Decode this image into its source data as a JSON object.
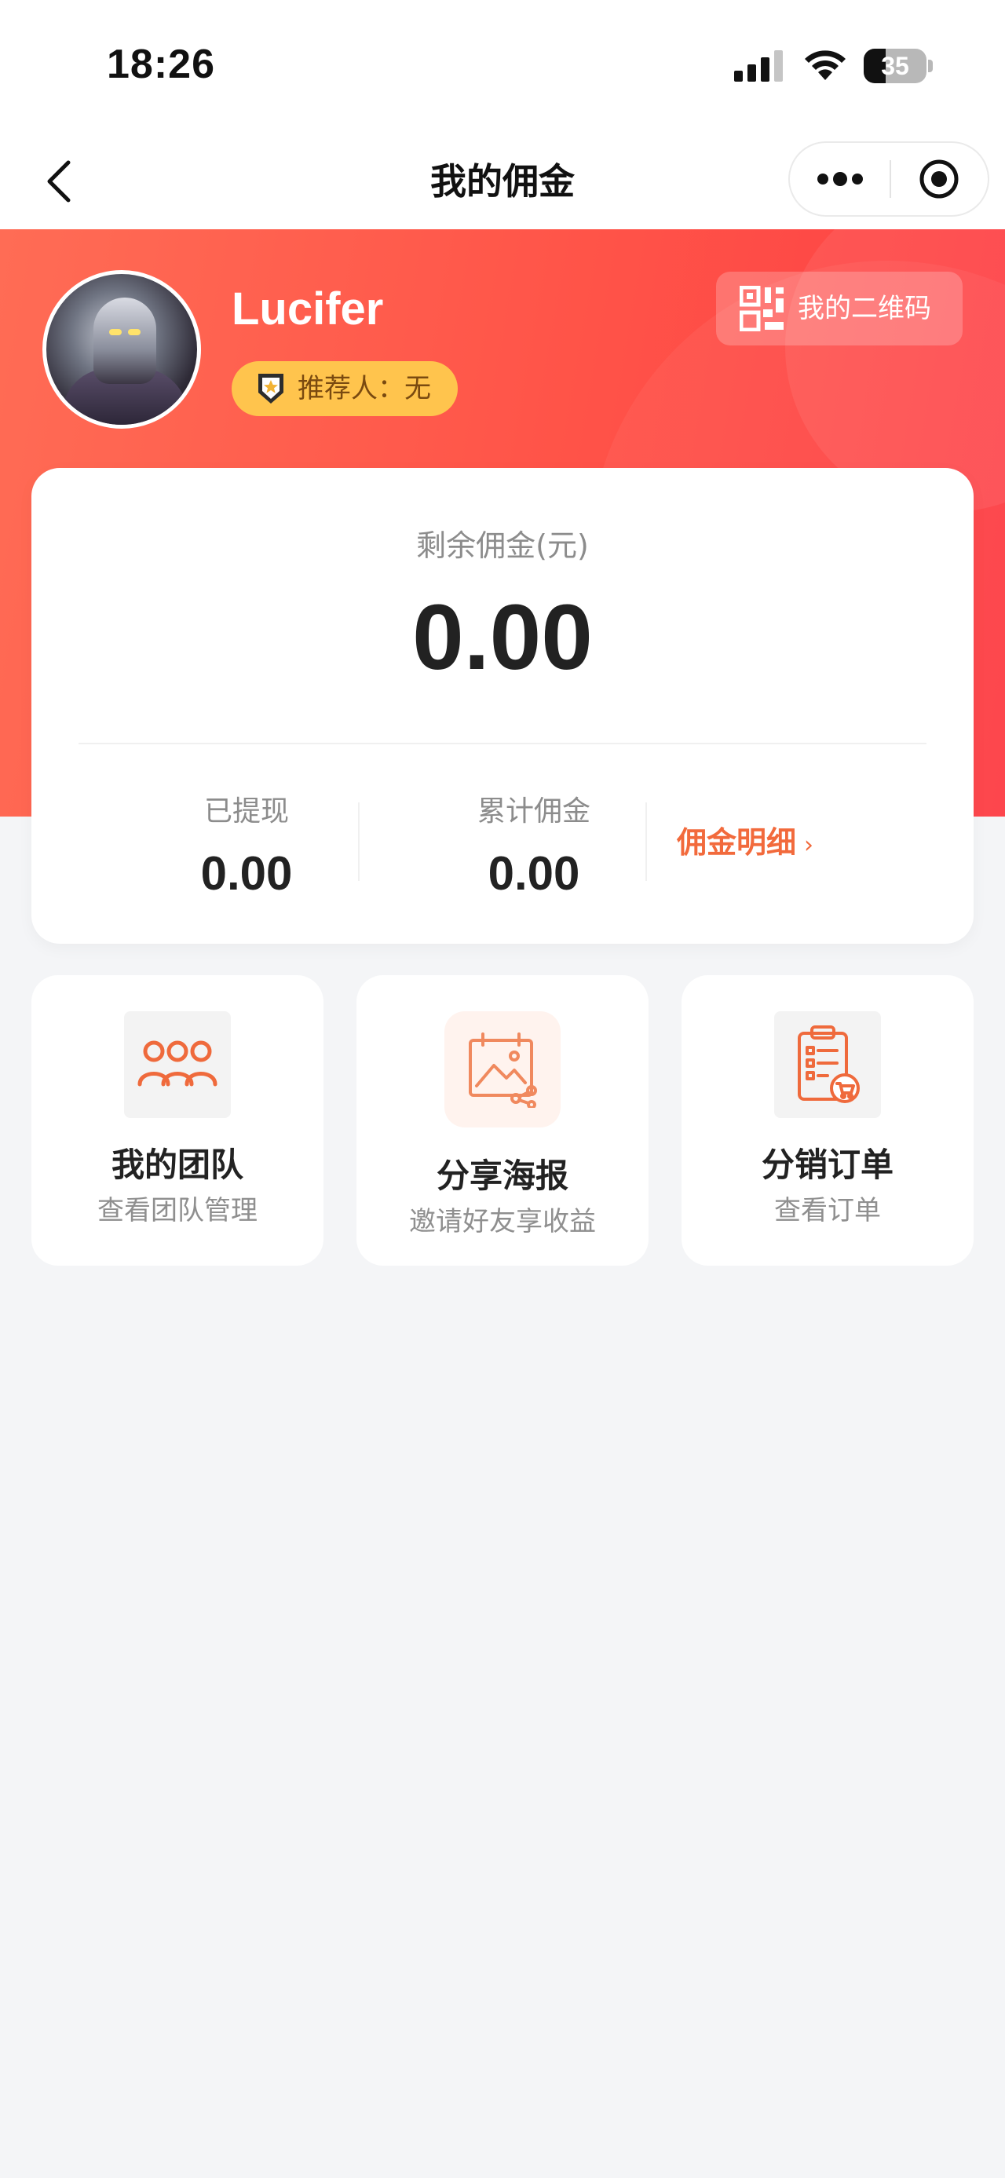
{
  "status_bar": {
    "time": "18:26",
    "battery_level": 35,
    "battery_text": "35",
    "icons": [
      "signal-icon",
      "wifi-icon",
      "battery-icon"
    ]
  },
  "nav": {
    "title": "我的佣金",
    "back_icon": "chevron-left-icon",
    "more_icon": "more-dots-icon",
    "close_icon": "target-close-icon"
  },
  "profile": {
    "name": "Lucifer",
    "referrer_label": "推荐人：无",
    "qr_label": "我的二维码"
  },
  "balance": {
    "label": "剩余佣金(元)",
    "value": "0.00",
    "withdrawn_label": "已提现",
    "withdrawn_value": "0.00",
    "total_label": "累计佣金",
    "total_value": "0.00",
    "detail_link": "佣金明细",
    "detail_chevron": "›"
  },
  "features": [
    {
      "title": "我的团队",
      "subtitle": "查看团队管理",
      "icon": "team-icon"
    },
    {
      "title": "分享海报",
      "subtitle": "邀请好友享收益",
      "icon": "poster-share-icon"
    },
    {
      "title": "分销订单",
      "subtitle": "查看订单",
      "icon": "order-clipboard-icon"
    }
  ],
  "colors": {
    "hero_gradient_start": "#ff6c55",
    "hero_gradient_end": "#fd3d44",
    "accent_orange": "#f26a3c",
    "badge_yellow": "#ffc44d",
    "page_background": "#f4f5f7"
  }
}
